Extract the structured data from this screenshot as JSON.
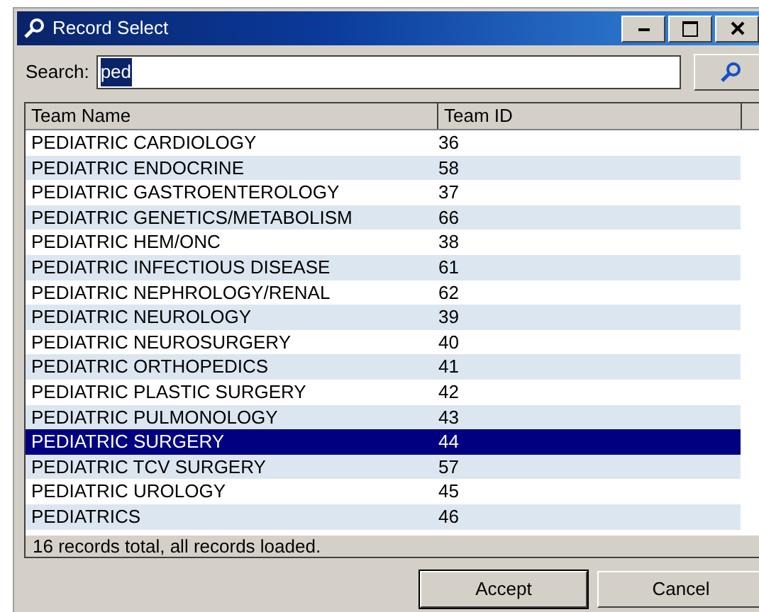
{
  "window": {
    "title": "Record Select"
  },
  "search": {
    "label": "Search:",
    "value": "ped",
    "value_selected": true
  },
  "table": {
    "columns": [
      "Team Name",
      "Team ID"
    ],
    "rows": [
      {
        "name": "PEDIATRIC CARDIOLOGY",
        "id": "36",
        "selected": false
      },
      {
        "name": "PEDIATRIC ENDOCRINE",
        "id": "58",
        "selected": false
      },
      {
        "name": "PEDIATRIC GASTROENTEROLOGY",
        "id": "37",
        "selected": false
      },
      {
        "name": "PEDIATRIC GENETICS/METABOLISM",
        "id": "66",
        "selected": false
      },
      {
        "name": "PEDIATRIC HEM/ONC",
        "id": "38",
        "selected": false
      },
      {
        "name": "PEDIATRIC INFECTIOUS DISEASE",
        "id": "61",
        "selected": false
      },
      {
        "name": "PEDIATRIC NEPHROLOGY/RENAL",
        "id": "62",
        "selected": false
      },
      {
        "name": "PEDIATRIC NEUROLOGY",
        "id": "39",
        "selected": false
      },
      {
        "name": "PEDIATRIC NEUROSURGERY",
        "id": "40",
        "selected": false
      },
      {
        "name": "PEDIATRIC ORTHOPEDICS",
        "id": "41",
        "selected": false
      },
      {
        "name": "PEDIATRIC PLASTIC SURGERY",
        "id": "42",
        "selected": false
      },
      {
        "name": "PEDIATRIC PULMONOLOGY",
        "id": "43",
        "selected": false
      },
      {
        "name": "PEDIATRIC SURGERY",
        "id": "44",
        "selected": true
      },
      {
        "name": "PEDIATRIC TCV SURGERY",
        "id": "57",
        "selected": false
      },
      {
        "name": "PEDIATRIC UROLOGY",
        "id": "45",
        "selected": false
      },
      {
        "name": "PEDIATRICS",
        "id": "46",
        "selected": false
      }
    ]
  },
  "status_bar": "16 records total, all records loaded.",
  "buttons": [
    "Accept",
    "Cancel"
  ]
}
